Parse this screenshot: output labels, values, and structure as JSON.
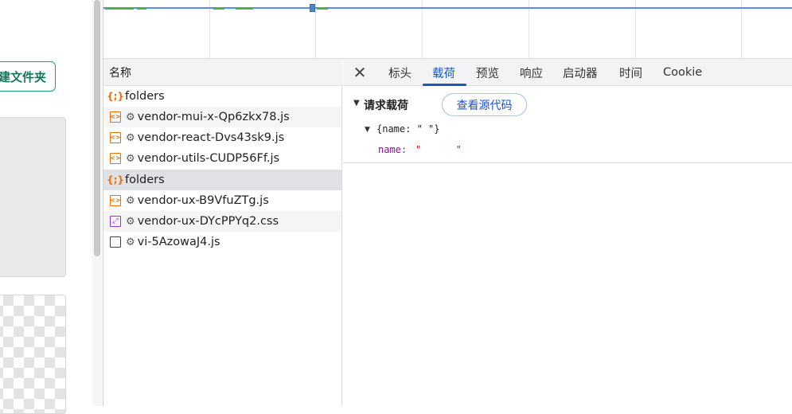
{
  "app": {
    "new_folder_label": "建文件夹"
  },
  "request_list": {
    "header": "名称",
    "rows": [
      {
        "name": "folders",
        "icon": "fetch-braces-icon",
        "state": "normal"
      },
      {
        "name": "vendor-mui-x-Qp6zkx78.js",
        "icon": "js-file-icon",
        "state": "alt"
      },
      {
        "name": "vendor-react-Dvs43sk9.js",
        "icon": "js-file-icon",
        "state": "normal"
      },
      {
        "name": "vendor-utils-CUDP56Ff.js",
        "icon": "js-file-icon",
        "state": "normal"
      },
      {
        "name": "folders",
        "icon": "fetch-braces-icon",
        "state": "selected"
      },
      {
        "name": "vendor-ux-B9VfuZTg.js",
        "icon": "js-file-icon",
        "state": "normal"
      },
      {
        "name": "vendor-ux-DYcPPYq2.css",
        "icon": "css-file-icon",
        "state": "alt"
      },
      {
        "name": "vi-5AzowaJ4.js",
        "icon": "document-icon",
        "state": "normal"
      }
    ]
  },
  "detail": {
    "tabs": [
      "标头",
      "载荷",
      "预览",
      "响应",
      "启动器",
      "时间",
      "Cookie"
    ],
    "active_tab": "载荷",
    "payload": {
      "section_title": "请求载荷",
      "view_source_label": "查看源代码",
      "object_summary": "{name: \" \"}",
      "property_key": "name:",
      "property_value": "\"      \""
    }
  },
  "colors": {
    "accent_blue": "#1a56c4",
    "brand_green": "#1aa37a",
    "js_orange": "#e8710a",
    "css_purple": "#9334e6"
  }
}
